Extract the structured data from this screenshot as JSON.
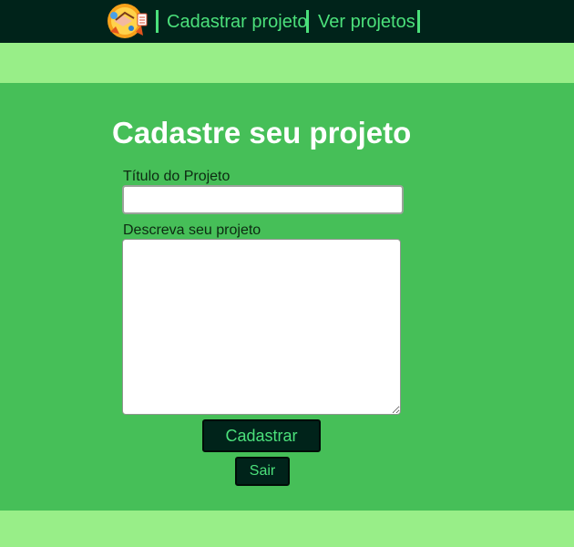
{
  "nav": {
    "logo_icon": "team-handshake-logo",
    "links": [
      {
        "label": "Cadastrar projeto"
      },
      {
        "label": "Ver projetos"
      }
    ]
  },
  "form": {
    "title": "Cadastre seu projeto",
    "project_title_label": "Título do Projeto",
    "project_title_value": "",
    "description_label": "Descreva seu projeto",
    "description_value": "",
    "submit_label": "Cadastrar",
    "exit_label": "Sair"
  },
  "colors": {
    "nav_background": "#00231a",
    "nav_link": "#4be07b",
    "page_background": "#98ee88",
    "form_band": "#46bf58",
    "button_background": "#00231a",
    "button_text": "#4be07b",
    "title_text": "#ffffff"
  }
}
